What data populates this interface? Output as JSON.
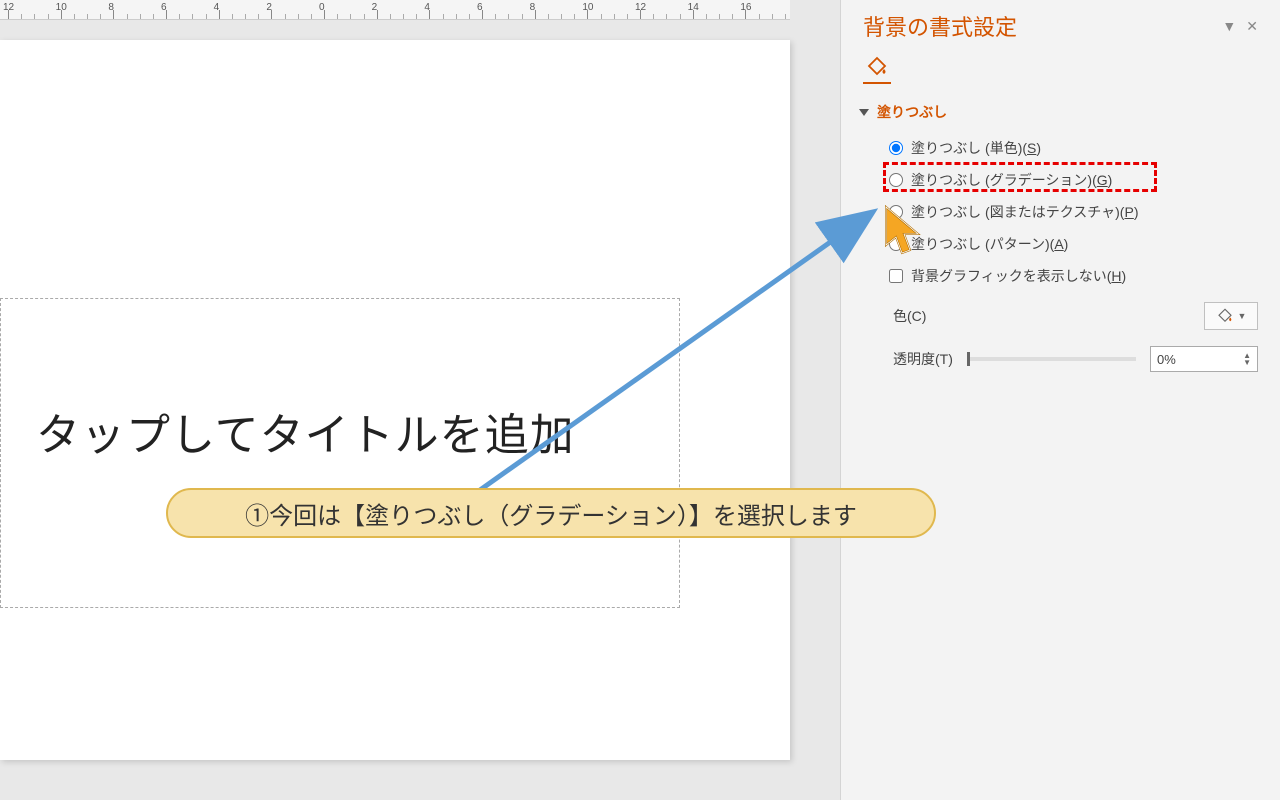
{
  "ruler": {
    "values": [
      "12",
      "10",
      "8",
      "6",
      "4",
      "2",
      "0",
      "2",
      "4",
      "6",
      "8",
      "10",
      "12",
      "14",
      "16"
    ]
  },
  "slide": {
    "title_placeholder": "タップしてタイトルを追加"
  },
  "callout": {
    "text": "①今回は【塗りつぶし（グラデーション）】を選択します"
  },
  "panel": {
    "title": "背景の書式設定",
    "section_fill": "塗りつぶし",
    "options": {
      "solid": "塗りつぶし (単色)(",
      "solid_key": "S",
      "gradient": "塗りつぶし (グラデーション)(",
      "gradient_key": "G",
      "picture": "塗りつぶし (図またはテクスチャ)(",
      "picture_key": "P",
      "pattern": "塗りつぶし (パターン)(",
      "pattern_key": "A",
      "hide_bg": "背景グラフィックを表示しない(",
      "hide_bg_key": "H"
    },
    "color_label_pre": "色(",
    "color_key": "C",
    "transparency_label_pre": "透明度(",
    "transparency_key": "T",
    "transparency_value": "0%"
  }
}
